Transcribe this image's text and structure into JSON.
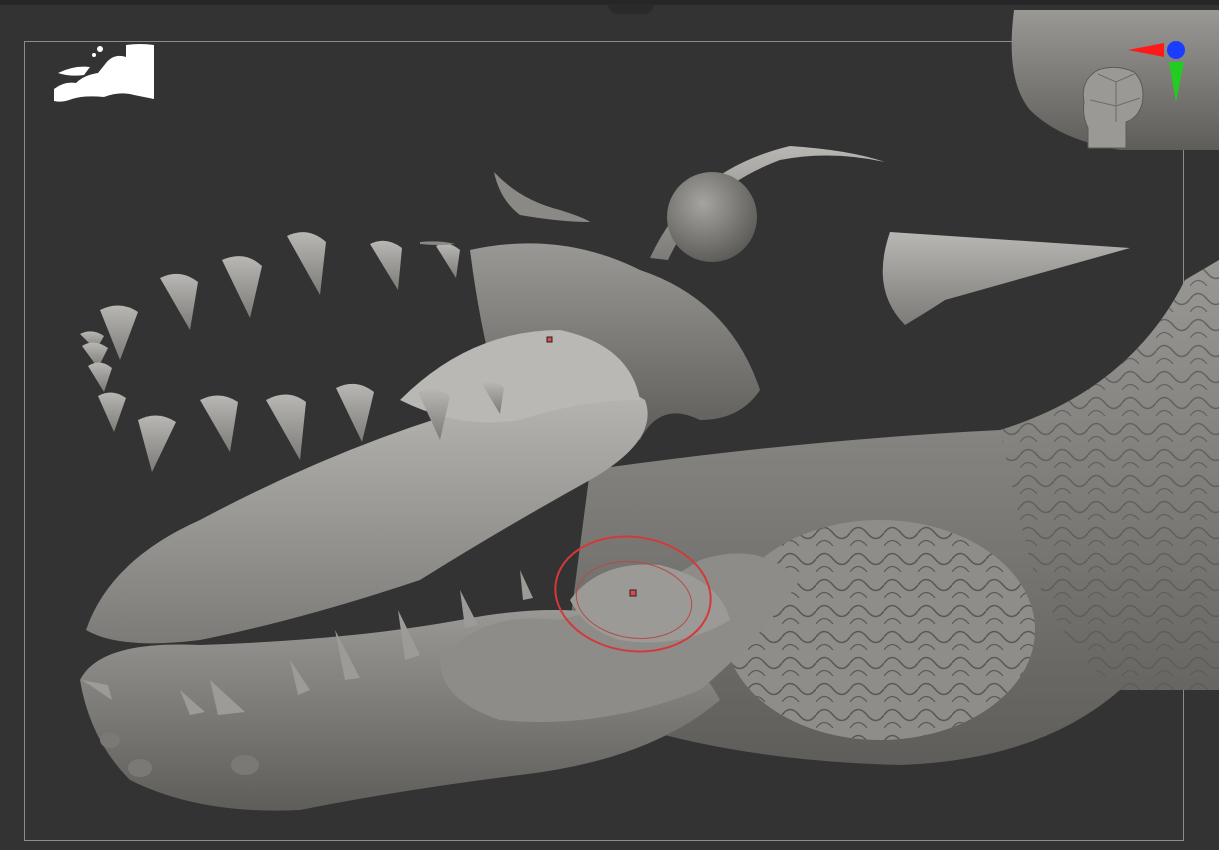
{
  "app": {
    "viewport": "zbrush-3d-viewport",
    "colors": {
      "background": "#333333",
      "frame": "#8c8c8c",
      "mesh": "#a7a5a2",
      "mesh_dark": "#6e6c69",
      "brush_cursor": "#d23a3a",
      "gizmo_x": "#ff1a1a",
      "gizmo_y": "#22cc22",
      "gizmo_z": "#1a3cff"
    }
  },
  "icons": {
    "thumbnail": "navigation-thumbnail-icon",
    "gizmo": "orientation-gizmo-icon",
    "head": "head-navigator-icon"
  }
}
